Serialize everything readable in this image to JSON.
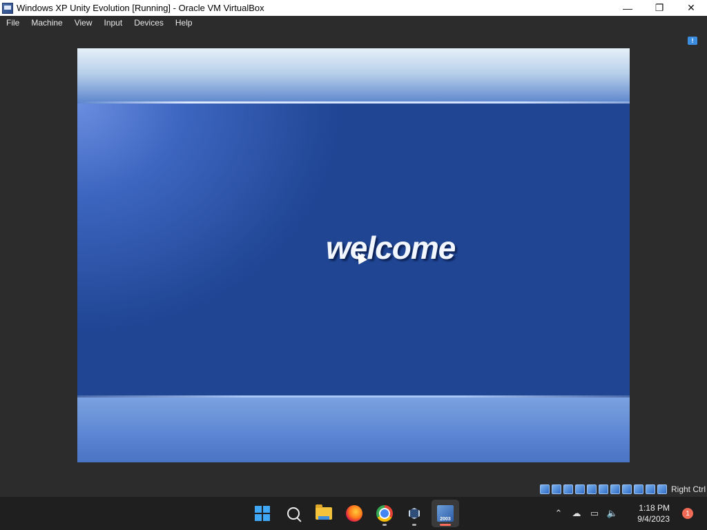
{
  "window": {
    "title": "Windows XP Unity Evolution [Running] - Oracle VM VirtualBox",
    "controls": {
      "minimize": "—",
      "maximize": "❐",
      "close": "✕"
    }
  },
  "menu": {
    "items": [
      "File",
      "Machine",
      "View",
      "Input",
      "Devices",
      "Help"
    ]
  },
  "vm": {
    "welcome_text": "welcome"
  },
  "statusbar": {
    "host_key_label": "Right Ctrl",
    "icons": [
      "hard-disk-icon",
      "optical-drive-icon",
      "audio-icon",
      "network-icon",
      "usb-icon",
      "shared-folders-icon",
      "display-icon",
      "recording-icon",
      "virtualization-icon",
      "guest-additions-icon",
      "keyboard-capture-icon"
    ]
  },
  "taskbar": {
    "apps": [
      "start-button",
      "search-button",
      "file-explorer",
      "firefox",
      "chrome",
      "virtualbox-manager",
      "virtualbox-vm-window"
    ],
    "vm_badge": "2003"
  },
  "tray": {
    "time": "1:18 PM",
    "date": "9/4/2023",
    "notification_count": "1",
    "icons": [
      "chevron-up-icon",
      "onedrive-offline-icon",
      "network-icon",
      "volume-icon"
    ]
  }
}
